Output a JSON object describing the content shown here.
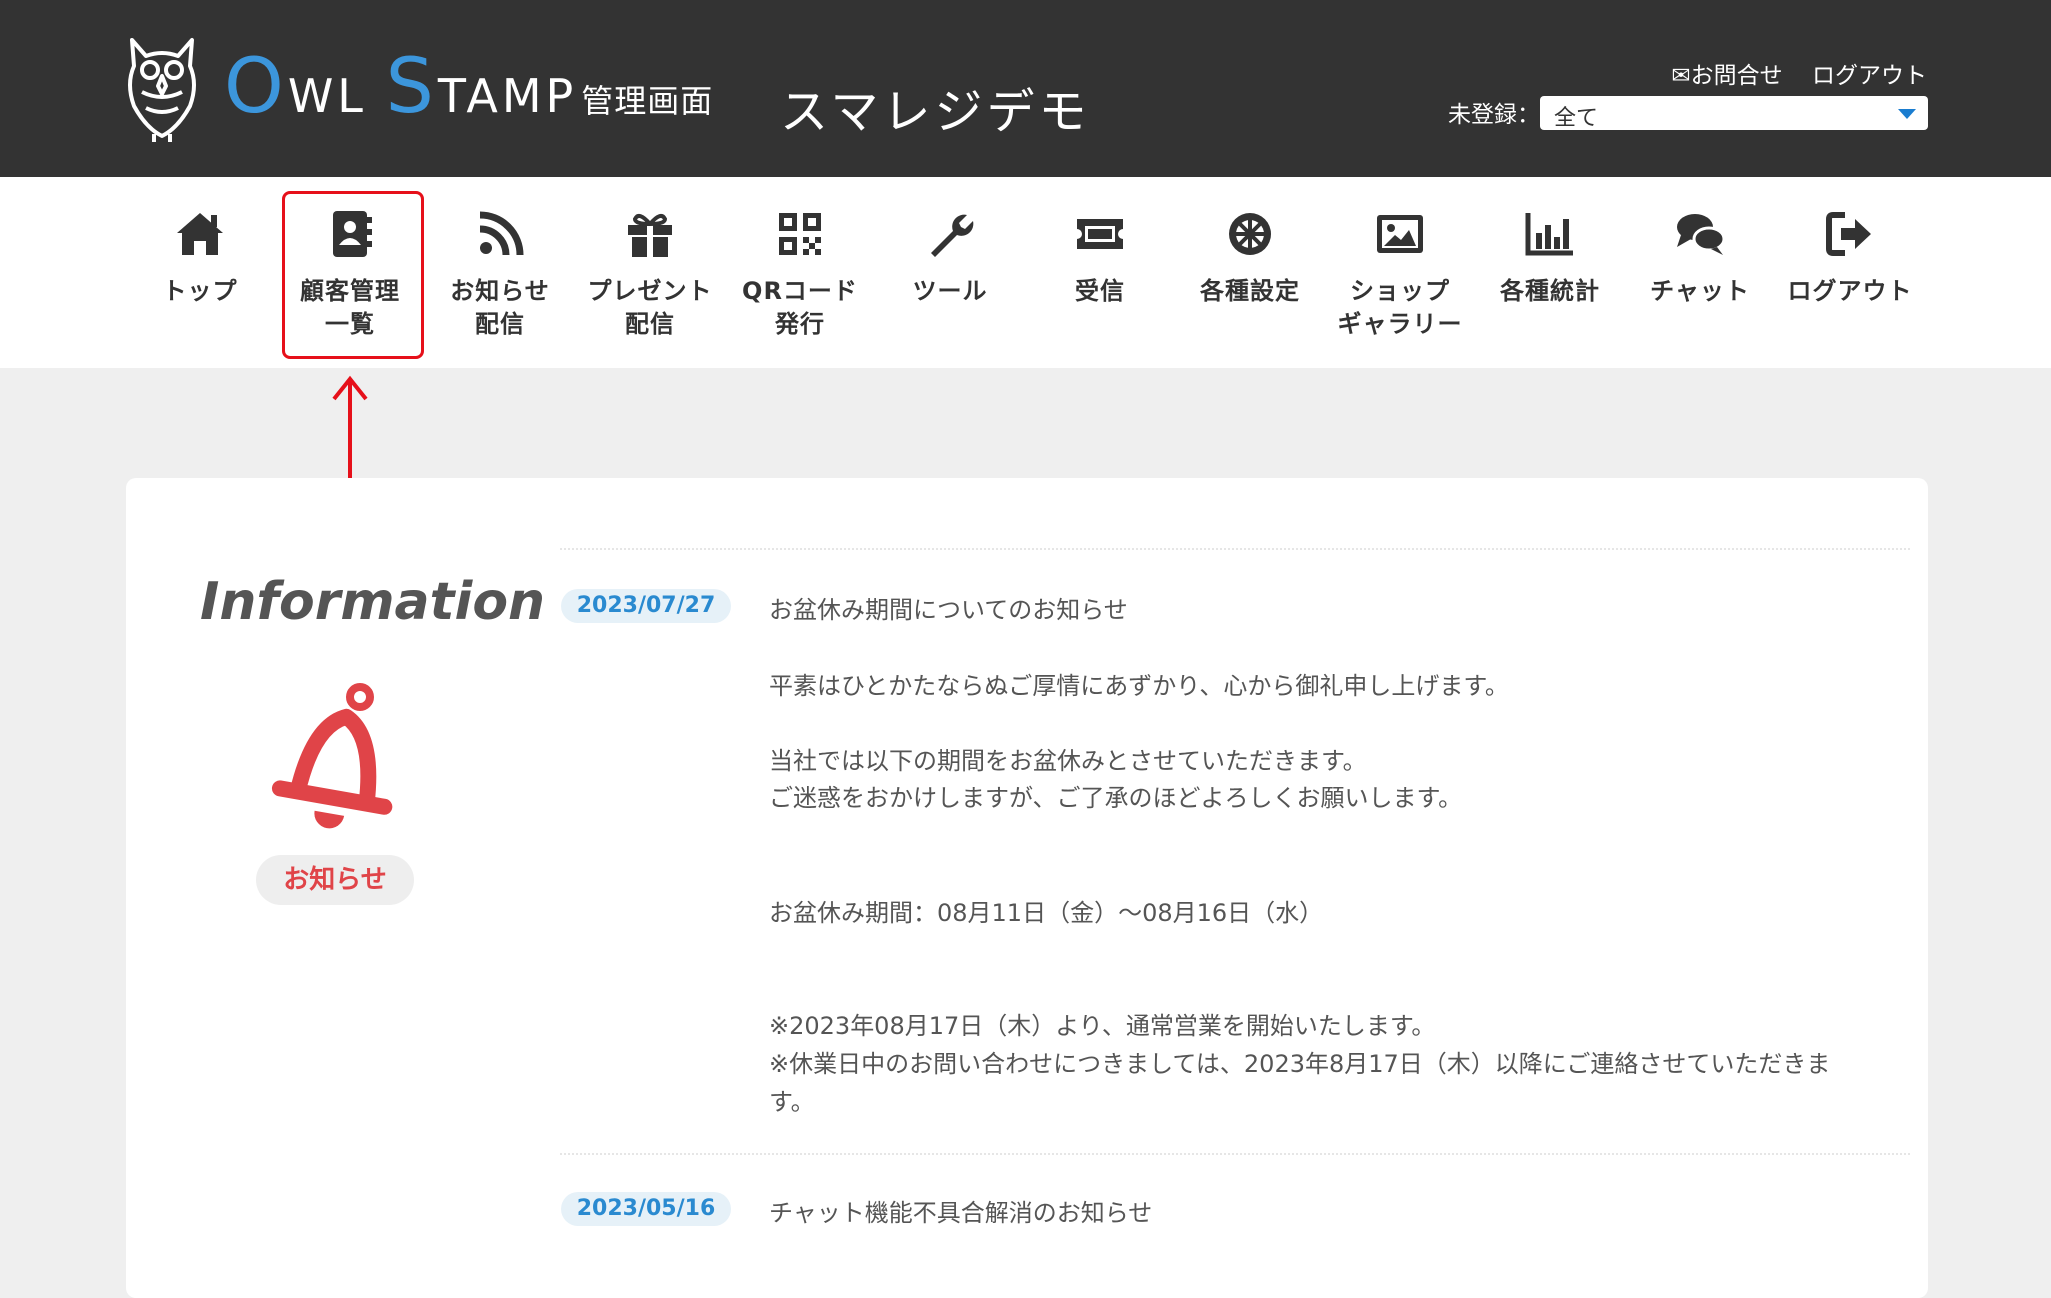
{
  "header": {
    "brand": {
      "o_cap": "O",
      "wl": "WL",
      "s_cap": "S",
      "tamp": "TAMP",
      "sub": "管理画面"
    },
    "shop_name": "スマレジデモ",
    "links": {
      "contact": "✉お問合せ",
      "logout": "ログアウト"
    },
    "unregistered_label": "未登録：",
    "filter_value": "全て"
  },
  "nav": {
    "items": [
      {
        "label": "トップ",
        "icon": "home-icon"
      },
      {
        "label": "顧客管理\n一覧",
        "icon": "address-book-icon"
      },
      {
        "label": "お知らせ\n配信",
        "icon": "rss-icon"
      },
      {
        "label": "プレゼント\n配信",
        "icon": "gift-icon"
      },
      {
        "label": "QRコード\n発行",
        "icon": "qrcode-icon"
      },
      {
        "label": "ツール",
        "icon": "wrench-icon"
      },
      {
        "label": "受信",
        "icon": "ticket-icon"
      },
      {
        "label": "各種設定",
        "icon": "settings-wheel-icon"
      },
      {
        "label": "ショップ\nギャラリー",
        "icon": "image-icon"
      },
      {
        "label": "各種統計",
        "icon": "bar-chart-icon"
      },
      {
        "label": "チャット",
        "icon": "chat-icon"
      },
      {
        "label": "ログアウト",
        "icon": "sign-out-icon"
      }
    ],
    "highlighted_index": 1
  },
  "info": {
    "title": "Information",
    "badge": "お知らせ",
    "news": [
      {
        "date": "2023/07/27",
        "title": "お盆休み期間についてのお知らせ",
        "lines": [
          "平素はひとかたならぬご厚情にあずかり、心から御礼申し上げます。",
          "当社では以下の期間をお盆休みとさせていただきます。",
          "ご迷惑をおかけしますが、ご了承のほどよろしくお願いします。",
          "お盆休み期間：08月11日（金）〜08月16日（水）",
          "※2023年08月17日（木）より、通常営業を開始いたします。",
          "※休業日中のお問い合わせにつきましては、2023年8月17日（木）以降にご連絡させていただきま",
          "す。"
        ]
      },
      {
        "date": "2023/05/16",
        "title": "チャット機能不具合解消のお知らせ"
      }
    ]
  },
  "colors": {
    "header_bg": "#333333",
    "brand_accent": "#3c96dc",
    "highlight_red": "#e6101a",
    "bell_red": "#e04448",
    "date_badge_text": "#2a8ad0"
  }
}
